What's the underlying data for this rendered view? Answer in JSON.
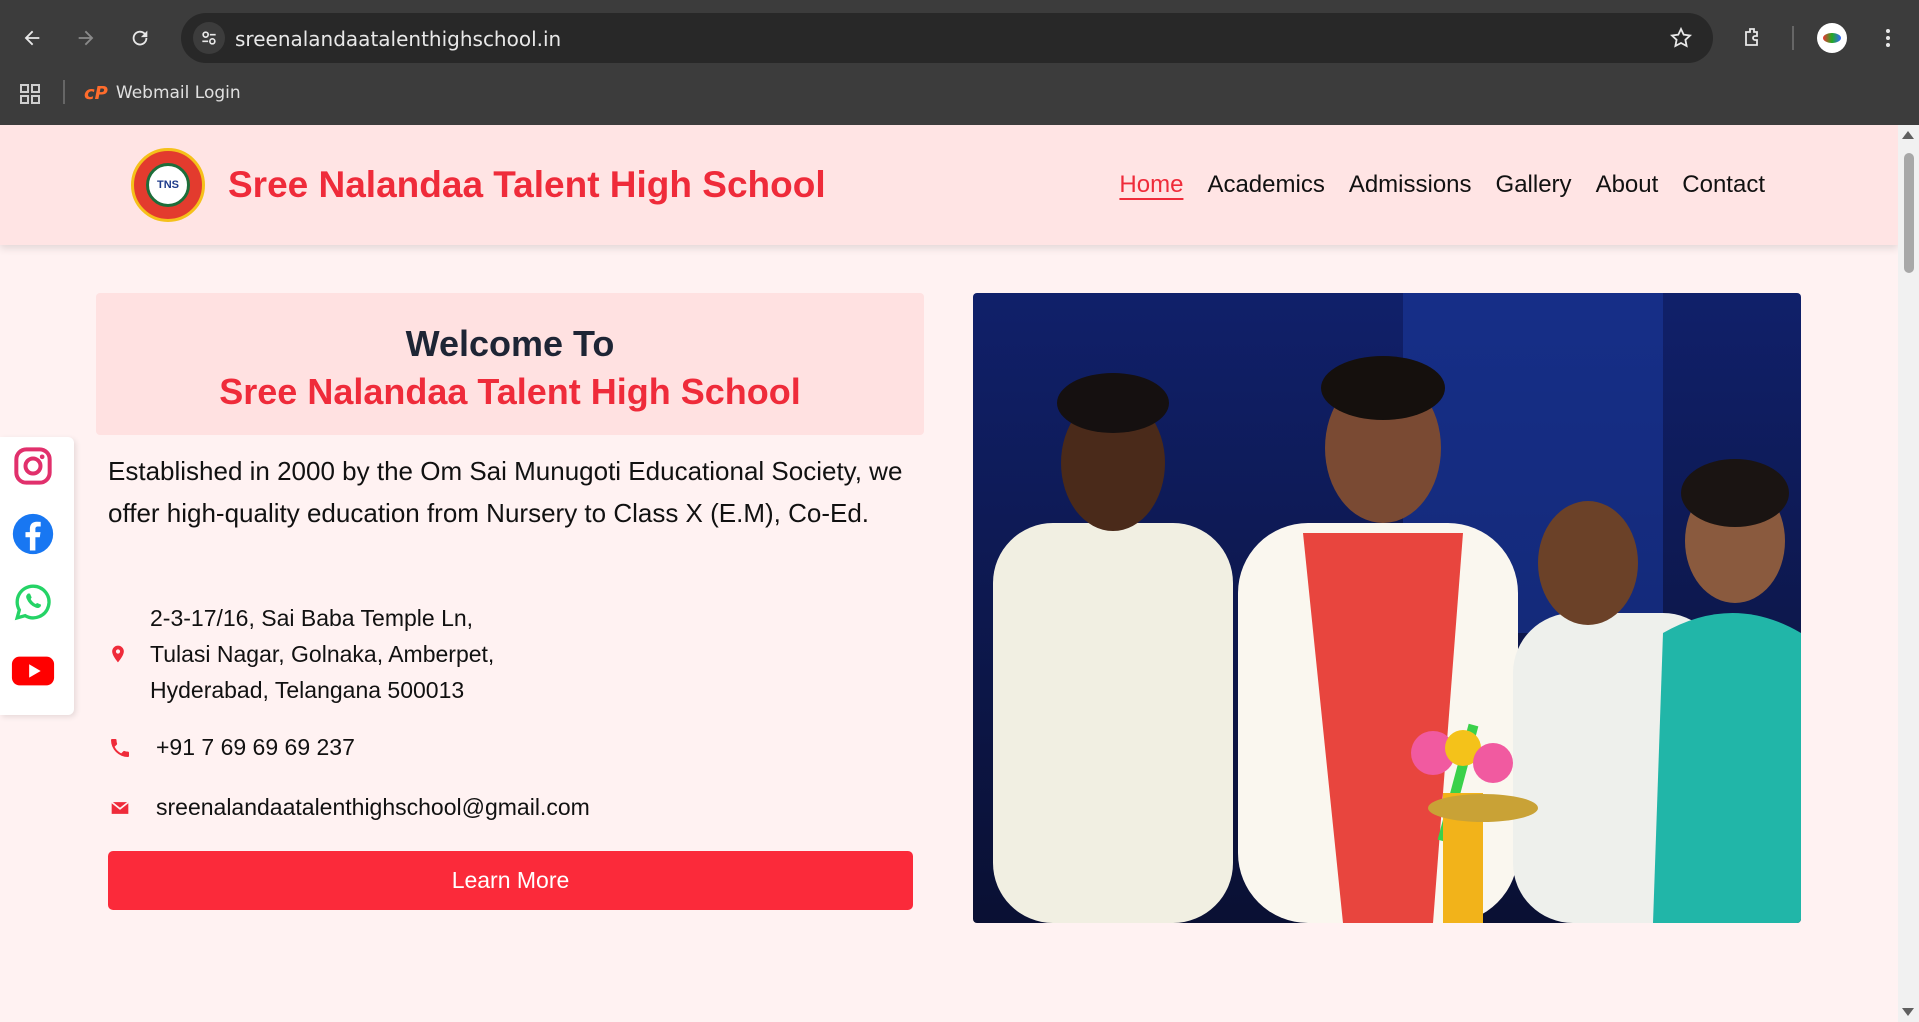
{
  "browser": {
    "url": "sreenalandaatalenthighschool.in",
    "bookmark_label": "Webmail Login",
    "bookmark_logo": "cP"
  },
  "header": {
    "logo_text": "TNS",
    "title": "Sree Nalandaa Talent High School",
    "nav": [
      "Home",
      "Academics",
      "Admissions",
      "Gallery",
      "About",
      "Contact"
    ]
  },
  "welcome": {
    "line1": "Welcome To",
    "line2": "Sree Nalandaa Talent High School"
  },
  "intro": "Established in 2000 by the Om Sai Munugoti Educational Society, we offer high-quality education from Nursery to Class X (E.M), Co-Ed.",
  "contact": {
    "address_line1": "2-3-17/16, Sai Baba Temple Ln,",
    "address_line2": "Tulasi Nagar, Golnaka, Amberpet,",
    "address_line3": "Hyderabad, Telangana 500013",
    "phone": "+91 7 69 69 69 237",
    "email": "sreenalandaatalenthighschool@gmail.com"
  },
  "cta": {
    "label": "Learn More"
  },
  "social": [
    "instagram-icon",
    "facebook-icon",
    "whatsapp-icon",
    "youtube-icon"
  ],
  "colors": {
    "accent": "#ef2b3a",
    "header_bg": "#ffe4e4",
    "page_bg": "#fff2f2",
    "button": "#fb2a3a"
  }
}
